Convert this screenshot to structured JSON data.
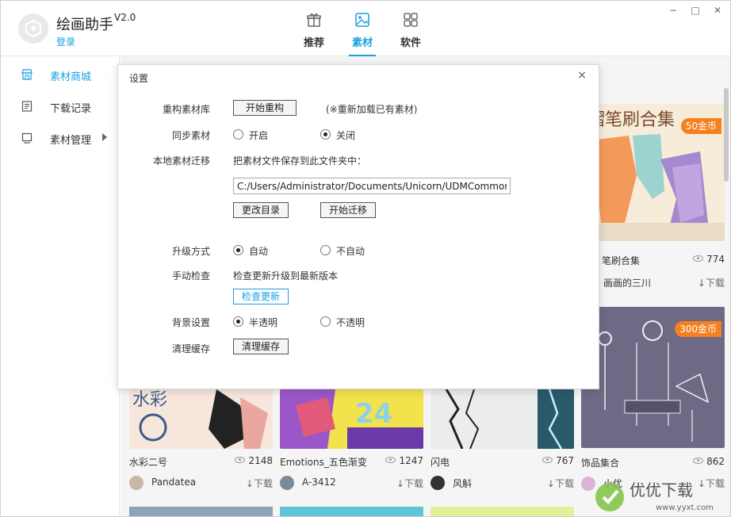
{
  "app": {
    "title": "绘画助手",
    "version": "V2.0",
    "login": "登录"
  },
  "topnav": [
    {
      "label": "推荐",
      "icon": "gift-icon"
    },
    {
      "label": "素材",
      "icon": "image-icon",
      "active": true
    },
    {
      "label": "软件",
      "icon": "grid-icon"
    }
  ],
  "window_controls": {
    "minimize": "−",
    "restore": "□",
    "close": "✕"
  },
  "sidebar": {
    "items": [
      {
        "label": "素材商城",
        "icon": "store-icon",
        "active": true
      },
      {
        "label": "下载记录",
        "icon": "list-icon"
      },
      {
        "label": "素材管理",
        "icon": "folder-icon",
        "has_submenu": true
      }
    ]
  },
  "cards": [
    {
      "title": "水彩二号",
      "views": "2148",
      "author": "Pandatea",
      "download": "下载"
    },
    {
      "title": "Emotions_五色渐变",
      "views": "1247",
      "author": "A-3412",
      "download": "下载"
    },
    {
      "title": "闪电",
      "views": "767",
      "author": "风斛",
      "download": "下载"
    },
    {
      "title": "饰品集合",
      "views": "862",
      "author": "小优",
      "download": "下载",
      "price": "300金币"
    },
    {
      "title": "笔刷合集",
      "views": "774",
      "author": "画画的三川",
      "download": "下载",
      "price": "50金币",
      "banner": "褶笔刷合集"
    }
  ],
  "dialog": {
    "title": "设置",
    "close": "×",
    "rebuild": {
      "label": "重构素材库",
      "button": "开始重构",
      "note": "(※重新加载已有素材)"
    },
    "sync": {
      "label": "同步素材",
      "on": "开启",
      "off": "关闭",
      "selected": "off"
    },
    "migrate": {
      "label": "本地素材迁移",
      "desc": "把素材文件保存到此文件夹中：",
      "path": "C:/Users/Administrator/Documents/Unicorn/UDMCommon",
      "change_button": "更改目录",
      "start_button": "开始迁移"
    },
    "upgrade": {
      "label": "升级方式",
      "auto": "自动",
      "manual": "不自动",
      "selected": "auto"
    },
    "check": {
      "label": "手动检查",
      "desc": "检查更新升级到最新版本",
      "button": "检查更新"
    },
    "background": {
      "label": "背景设置",
      "semi": "半透明",
      "opaque": "不透明",
      "selected": "semi"
    },
    "cache": {
      "label": "清理缓存",
      "button": "清理缓存"
    }
  },
  "colors": {
    "accent": "#1aa0e0",
    "badge": "#f5801f"
  }
}
